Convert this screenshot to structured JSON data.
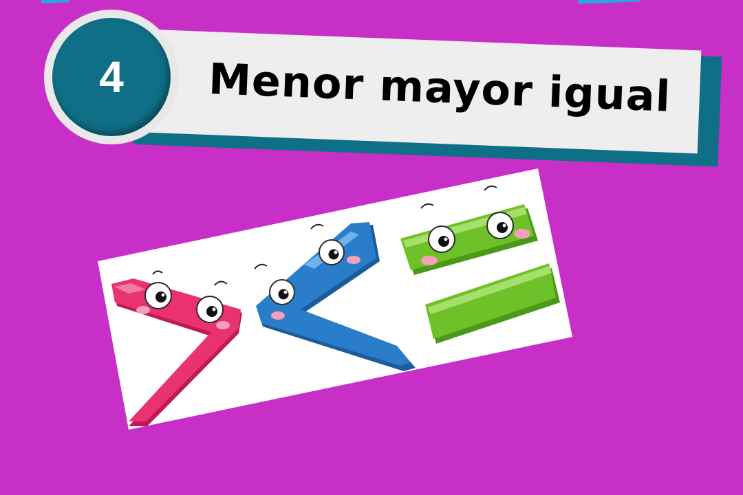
{
  "header": {
    "number": "4",
    "title": "Menor mayor igual"
  },
  "illustration": {
    "symbols": [
      "greater-than",
      "less-than",
      "equals"
    ],
    "colors": {
      "greater_than": "#e8336f",
      "less_than": "#2a7ec9",
      "equals": "#6fc12a"
    }
  },
  "colors": {
    "background": "#c72fc6",
    "badge": "#0f6f87",
    "banner": "#eeeeee"
  }
}
